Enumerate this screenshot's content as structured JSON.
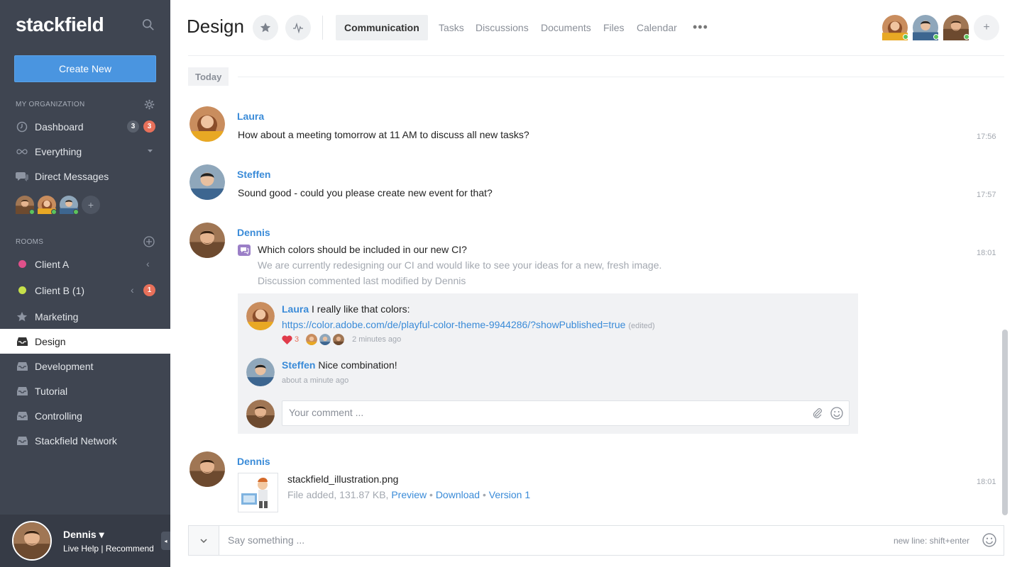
{
  "colors": {
    "sidebar_bg": "#3f4551",
    "accent": "#4a95e0",
    "link": "#3a8bd8",
    "badge_red": "#e8705a",
    "online": "#5cc45c"
  },
  "sidebar": {
    "logo": "stackfield",
    "create_label": "Create New",
    "org_section": "MY ORGANIZATION",
    "rooms_section": "ROOMS",
    "items": {
      "dashboard": {
        "label": "Dashboard",
        "count_gray": "3",
        "count_red": "3"
      },
      "everything": {
        "label": "Everything"
      },
      "direct_messages": {
        "label": "Direct Messages"
      }
    },
    "rooms": [
      {
        "label": "Client A",
        "dot_color": "#e0508a"
      },
      {
        "label": "Client B (1)",
        "dot_color": "#c6e04a",
        "count": "1"
      },
      {
        "label": "Marketing",
        "icon": "star-icon"
      },
      {
        "label": "Design",
        "icon": "inbox-icon",
        "active": true
      },
      {
        "label": "Development",
        "icon": "inbox-icon"
      },
      {
        "label": "Tutorial",
        "icon": "inbox-icon"
      },
      {
        "label": "Controlling",
        "icon": "inbox-icon"
      },
      {
        "label": "Stackfield Network",
        "icon": "inbox-icon"
      }
    ],
    "footer": {
      "name": "Dennis ▾",
      "links": "Live Help | Recommend"
    }
  },
  "header": {
    "title": "Design",
    "tabs": [
      "Communication",
      "Tasks",
      "Discussions",
      "Documents",
      "Files",
      "Calendar"
    ],
    "more": "•••",
    "add": "+"
  },
  "feed": {
    "day_label": "Today",
    "messages": [
      {
        "author": "Laura",
        "text": "How about a meeting tomorrow at 11 AM to discuss all new tasks?",
        "time": "17:56"
      },
      {
        "author": "Steffen",
        "text": "Sound good - could you please create new event for that?",
        "time": "17:57"
      },
      {
        "author": "Dennis",
        "title": "Which colors should be included in our new CI?",
        "body": "We are currently redesigning our CI and would like to see your ideas for a new, fresh image.",
        "meta": "Discussion commented last modified by Dennis",
        "time": "18:01"
      }
    ],
    "thread": {
      "c1": {
        "author": "Laura",
        "text": "I really like that colors:",
        "link": "https://color.adobe.com/de/playful-color-theme-9944286/?showPublished=true",
        "edited": "(edited)",
        "likes": "3",
        "ago": "2 minutes ago"
      },
      "c2": {
        "author": "Steffen",
        "text": "Nice combination!",
        "ago": "about a minute ago"
      },
      "comment_placeholder": "Your comment ..."
    },
    "file_msg": {
      "author": "Dennis",
      "time": "18:01",
      "filename": "stackfield_illustration.png",
      "meta_prefix": "File added, 131.87 KB, ",
      "preview": "Preview",
      "download": "Download",
      "version": "Version 1",
      "sep": " • "
    }
  },
  "composer": {
    "placeholder": "Say something ...",
    "hint": "new line: shift+enter"
  }
}
